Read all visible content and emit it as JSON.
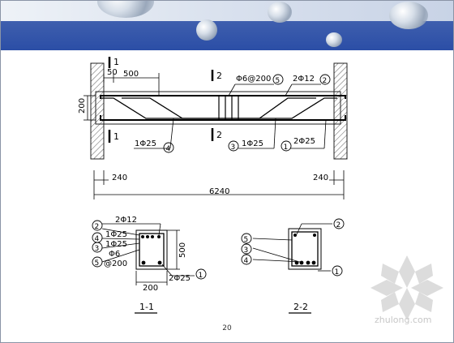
{
  "page_number": "20",
  "watermark_text": "zhulong.com",
  "elevation": {
    "sec1_mark": "1",
    "sec2_mark": "2",
    "dim_50": "50",
    "dim_500": "500",
    "dim_200": "200",
    "stirrup_label": "Φ6@200",
    "stirrup_mark": "5",
    "top_bar_label": "2Φ12",
    "top_bar_mark": "2",
    "bent_bar_4_label": "1Φ25",
    "bent_bar_4_mark": "4",
    "bent_bar_3_label": "1Φ25",
    "bent_bar_3_mark": "3",
    "bottom_bar_label": "2Φ25",
    "bottom_bar_mark": "1",
    "support_left": "240",
    "support_right": "240",
    "span_total": "6240"
  },
  "section_1": {
    "title": "1-1",
    "top_label": "2Φ12",
    "rows": [
      {
        "mark": "2",
        "text": ""
      },
      {
        "mark": "4",
        "text": "1Φ25"
      },
      {
        "mark": "3",
        "text": "1Φ25"
      },
      {
        "mark": "",
        "text": "Φ6"
      },
      {
        "mark": "5",
        "text": "@200"
      }
    ],
    "height": "500",
    "width": "200",
    "bottom_label": "2Φ25",
    "bottom_mark": "1"
  },
  "section_2": {
    "title": "2-2",
    "marks": [
      "2",
      "5",
      "3",
      "4",
      "1"
    ]
  }
}
